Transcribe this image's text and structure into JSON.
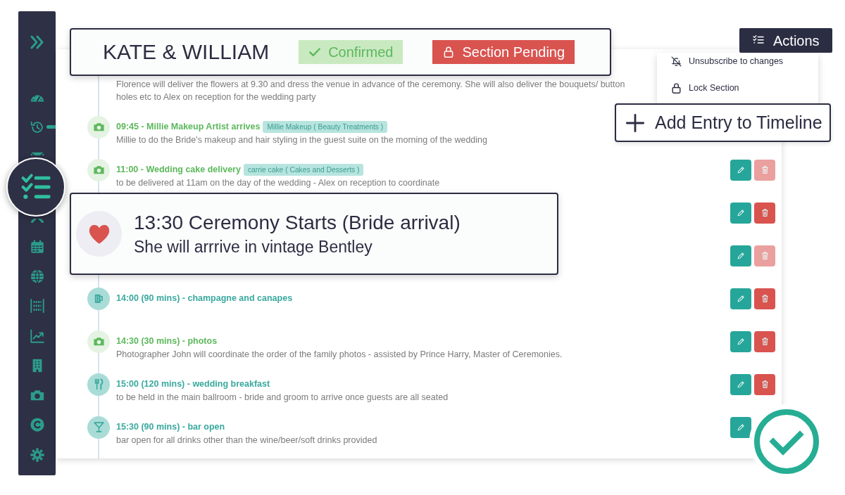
{
  "sidebar": {
    "items": [
      {
        "kind": "dashboard",
        "selected": false,
        "hovered": false
      },
      {
        "kind": "history",
        "selected": false,
        "hovered": true
      },
      {
        "kind": "mail",
        "selected": false,
        "hovered": false
      },
      {
        "kind": "checklist",
        "selected": true,
        "hovered": false
      },
      {
        "kind": "tools",
        "selected": false,
        "hovered": false
      },
      {
        "kind": "calendar",
        "selected": false,
        "hovered": false
      },
      {
        "kind": "globe",
        "selected": false,
        "hovered": false
      },
      {
        "kind": "abacus",
        "selected": false,
        "hovered": false
      },
      {
        "kind": "chart",
        "selected": false,
        "hovered": false
      },
      {
        "kind": "building",
        "selected": false,
        "hovered": false
      },
      {
        "kind": "camera",
        "selected": false,
        "hovered": false
      },
      {
        "kind": "copyright",
        "selected": false,
        "hovered": false
      },
      {
        "kind": "settings",
        "selected": false,
        "hovered": false
      }
    ]
  },
  "header": {
    "title": "KATE & WILLIAM",
    "badges": [
      {
        "kind": "confirmed",
        "label": "Confirmed"
      },
      {
        "kind": "pending",
        "label": "Section Pending"
      }
    ]
  },
  "actions_menu": {
    "label": "Actions",
    "items": [
      {
        "kind": "unsubscribe",
        "label": "Unsubscribe to changes"
      },
      {
        "kind": "lock",
        "label": "Lock Section"
      }
    ]
  },
  "add_entry_button": {
    "label": "Add Entry to Timeline"
  },
  "timeline": {
    "entries": [
      {
        "description": "Florence will deliver the flowers at 9.30 and dress the venue in advance of the ceremony. She will also deliver the bouquets/ button holes etc to Alex on reception for the wedding party"
      },
      {
        "kind": "photo",
        "title": "09:45 - Millie Makeup Artist arrives",
        "tag": "Millie Makeup ( Beauty Treatments )",
        "description": "Millie to do the Bride's makeup and hair styling in the guest suite on the morning of the wedding"
      },
      {
        "kind": "photo",
        "title": "11:00 - Wedding cake delivery",
        "tag": "carrie cake ( Cakes and Desserts )",
        "description": "to be delivered at 11am on the day of the wedding - Alex on reception to coordinate",
        "actions": [
          {
            "kind": "edit",
            "disabled": false
          },
          {
            "kind": "delete",
            "disabled": true
          }
        ]
      },
      {
        "actions": [
          {
            "kind": "edit",
            "disabled": false
          },
          {
            "kind": "delete",
            "disabled": false
          }
        ]
      },
      {
        "actions": [
          {
            "kind": "edit",
            "disabled": false
          },
          {
            "kind": "delete",
            "disabled": true
          }
        ]
      },
      {
        "kind": "drinks",
        "title": "14:00 (90 mins) - champagne and canapes",
        "actions": [
          {
            "kind": "edit",
            "disabled": false
          },
          {
            "kind": "delete",
            "disabled": false
          }
        ]
      },
      {
        "kind": "photo",
        "title": "14:30 (30 mins) - photos",
        "description": "Photographer John will coordinate the order of the family photos - assisted by Prince Harry, Master of Ceremonies.",
        "actions": [
          {
            "kind": "edit",
            "disabled": false
          },
          {
            "kind": "delete",
            "disabled": false
          }
        ]
      },
      {
        "kind": "dining",
        "title": "15:00 (120 mins) - wedding breakfast",
        "description": "to be held in the main ballroom - bride and groom to arrive once guests are all seated",
        "actions": [
          {
            "kind": "edit",
            "disabled": false
          },
          {
            "kind": "delete",
            "disabled": false
          }
        ]
      },
      {
        "kind": "bar",
        "title": "15:30 (90 mins) - bar open",
        "description": "bar open for all drinks other than the wine/beer/soft drinks provided",
        "actions": [
          {
            "kind": "edit",
            "disabled": false
          }
        ]
      }
    ]
  },
  "highlight": {
    "title": "13:30 Ceremony Starts (Bride arrival)",
    "subtitle": "She will arrrive in vintage Bentley"
  }
}
